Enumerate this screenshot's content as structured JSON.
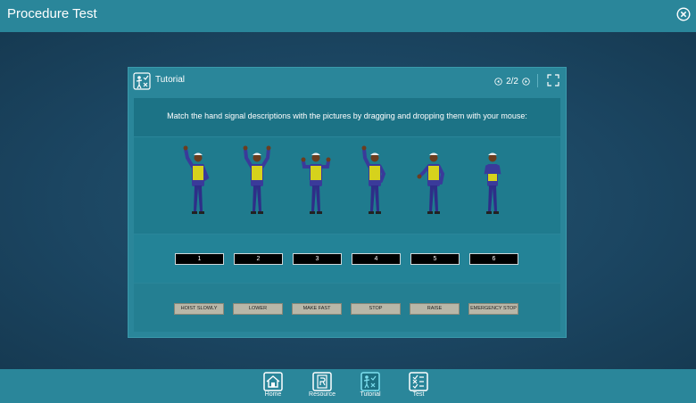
{
  "app": {
    "title": "Procedure Test"
  },
  "dialog": {
    "title": "Tutorial",
    "page_indicator": "2/2",
    "instruction": "Match the hand signal descriptions with the pictures by dragging and dropping them with your mouse:"
  },
  "figures": [
    {
      "signal": "hoist slowly"
    },
    {
      "signal": "raise"
    },
    {
      "signal": "stop"
    },
    {
      "signal": "hoist slowly"
    },
    {
      "signal": "lower"
    },
    {
      "signal": "make fast"
    }
  ],
  "slots": [
    "1",
    "2",
    "3",
    "4",
    "5",
    "6"
  ],
  "labels": [
    "HOIST SLOWLY",
    "LOWER",
    "MAKE FAST",
    "STOP",
    "RAISE",
    "EMERGENCY STOP"
  ],
  "bottom_nav": {
    "home": "Home",
    "resource": "Resource",
    "tutorial": "Tutorial",
    "test": "Test"
  },
  "colors": {
    "bar": "#2a869a",
    "background": "#1b4561",
    "active_nav": "#7de0f0"
  }
}
